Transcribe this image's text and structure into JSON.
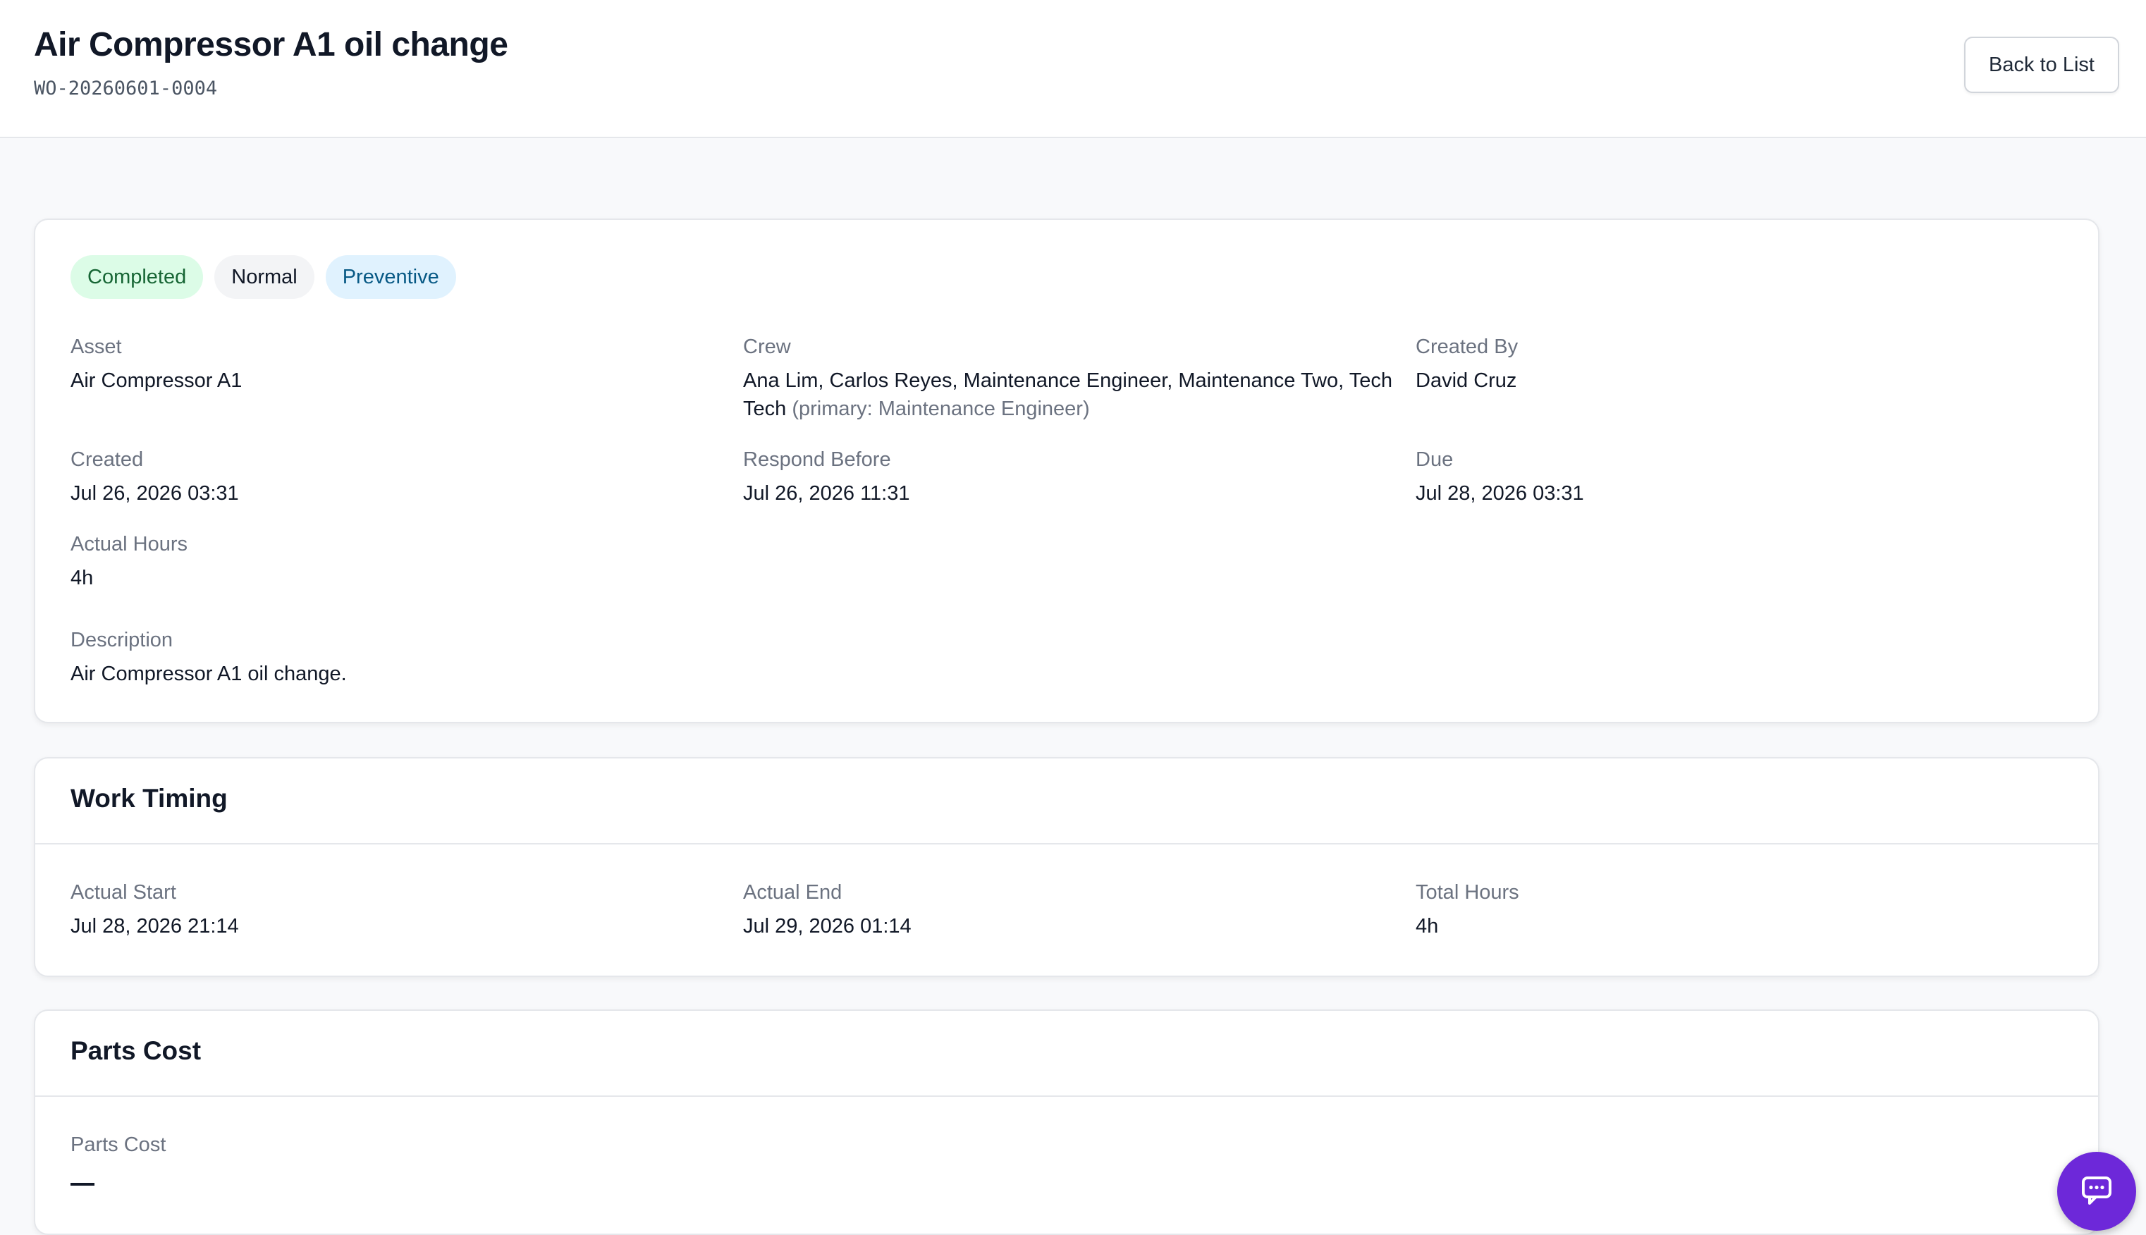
{
  "header": {
    "title": "Air Compressor A1 oil change",
    "wo_number": "WO-20260601-0004",
    "back_label": "Back to List"
  },
  "badges": {
    "status": "Completed",
    "priority": "Normal",
    "type": "Preventive"
  },
  "details": {
    "asset": {
      "label": "Asset",
      "value": "Air Compressor A1"
    },
    "crew": {
      "label": "Crew",
      "value": "Ana Lim, Carlos Reyes, Maintenance Engineer, Maintenance Two, Tech Tech",
      "primary_note": "(primary: Maintenance Engineer)"
    },
    "created_by": {
      "label": "Created By",
      "value": "David Cruz"
    },
    "created": {
      "label": "Created",
      "value": "Jul 26, 2026 03:31"
    },
    "respond_before": {
      "label": "Respond Before",
      "value": "Jul 26, 2026 11:31"
    },
    "due": {
      "label": "Due",
      "value": "Jul 28, 2026 03:31"
    },
    "actual_hours": {
      "label": "Actual Hours",
      "value": "4h"
    },
    "description": {
      "label": "Description",
      "value": "Air Compressor A1 oil change."
    }
  },
  "work_timing": {
    "title": "Work Timing",
    "actual_start": {
      "label": "Actual Start",
      "value": "Jul 28, 2026 21:14"
    },
    "actual_end": {
      "label": "Actual End",
      "value": "Jul 29, 2026 01:14"
    },
    "total_hours": {
      "label": "Total Hours",
      "value": "4h"
    }
  },
  "parts_cost": {
    "title": "Parts Cost",
    "label": "Parts Cost",
    "value": "—"
  },
  "colors": {
    "status_bg": "#dcfce7",
    "status_text": "#166534",
    "type_bg": "#e0f2fe",
    "type_text": "#075985",
    "fab": "#6d28d9"
  },
  "icons": {
    "chat_fab": "chat-bubble-icon"
  }
}
